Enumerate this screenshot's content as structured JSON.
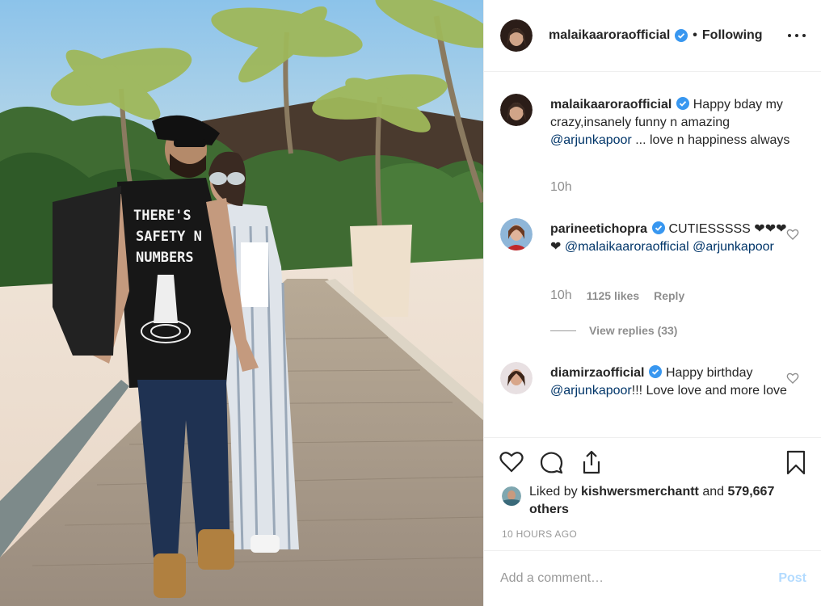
{
  "header": {
    "username": "malaikaaroraofficial",
    "separator": "•",
    "follow_status": "Following"
  },
  "comments": [
    {
      "username": "malaikaaroraofficial",
      "text_before": "Happy bday my crazy,insanely funny n amazing",
      "mention": "@arjunkapoor",
      "text_after": "... love n happiness always",
      "time": "10h"
    },
    {
      "username": "parineetichopra",
      "text_before": "CUTIESSSSS ❤❤❤❤",
      "mention": "@malaikaaroraofficial",
      "mention2": "@arjunkapoor",
      "time": "10h",
      "likes": "1125 likes",
      "reply": "Reply",
      "view_replies": "View replies (33)"
    },
    {
      "username": "diamirzaofficial",
      "text_before": "Happy birthday",
      "mention": "@arjunkapoor",
      "text_after": "!!! Love love and more love"
    }
  ],
  "liked_by": {
    "prefix": "Liked by",
    "user": "kishwersmerchantt",
    "and": "and",
    "others": "579,667 others"
  },
  "time_ago": "10 HOURS AGO",
  "add_comment": {
    "placeholder": "Add a comment…",
    "post_label": "Post"
  },
  "colors": {
    "verified": "#3897f0",
    "mention": "#003569",
    "post_disabled": "#b3dbff",
    "muted": "#8e8e8e"
  },
  "icons": [
    "heart-icon",
    "comment-icon",
    "share-icon",
    "bookmark-icon",
    "more-options-icon",
    "verified-icon"
  ]
}
